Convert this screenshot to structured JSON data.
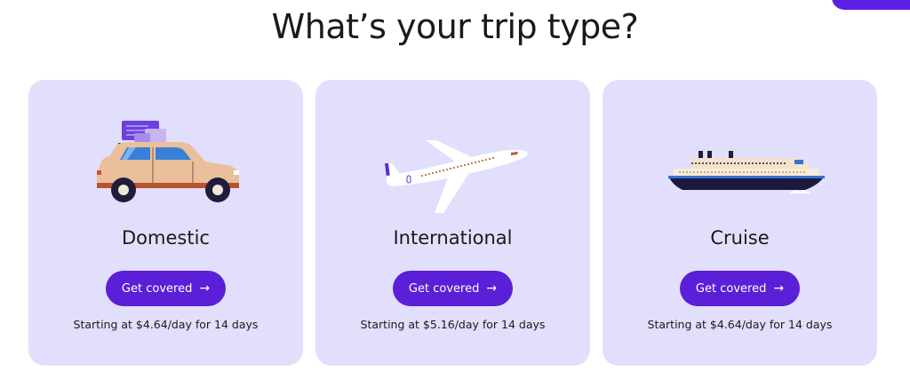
{
  "heading": "What’s your trip type?",
  "cards": [
    {
      "title": "Domestic",
      "button_label": "Get covered",
      "button_arrow": "→",
      "price_text": "Starting at $4.64/day for 14 days",
      "illustration": "car-icon"
    },
    {
      "title": "International",
      "button_label": "Get covered",
      "button_arrow": "→",
      "price_text": "Starting at $5.16/day for 14 days",
      "illustration": "airplane-icon"
    },
    {
      "title": "Cruise",
      "button_label": "Get covered",
      "button_arrow": "→",
      "price_text": "Starting at $4.64/day for 14 days",
      "illustration": "cruise-ship-icon"
    }
  ],
  "colors": {
    "accent": "#5a1fd6",
    "card_background": "#e2dffd",
    "text": "#1a1a1a"
  }
}
